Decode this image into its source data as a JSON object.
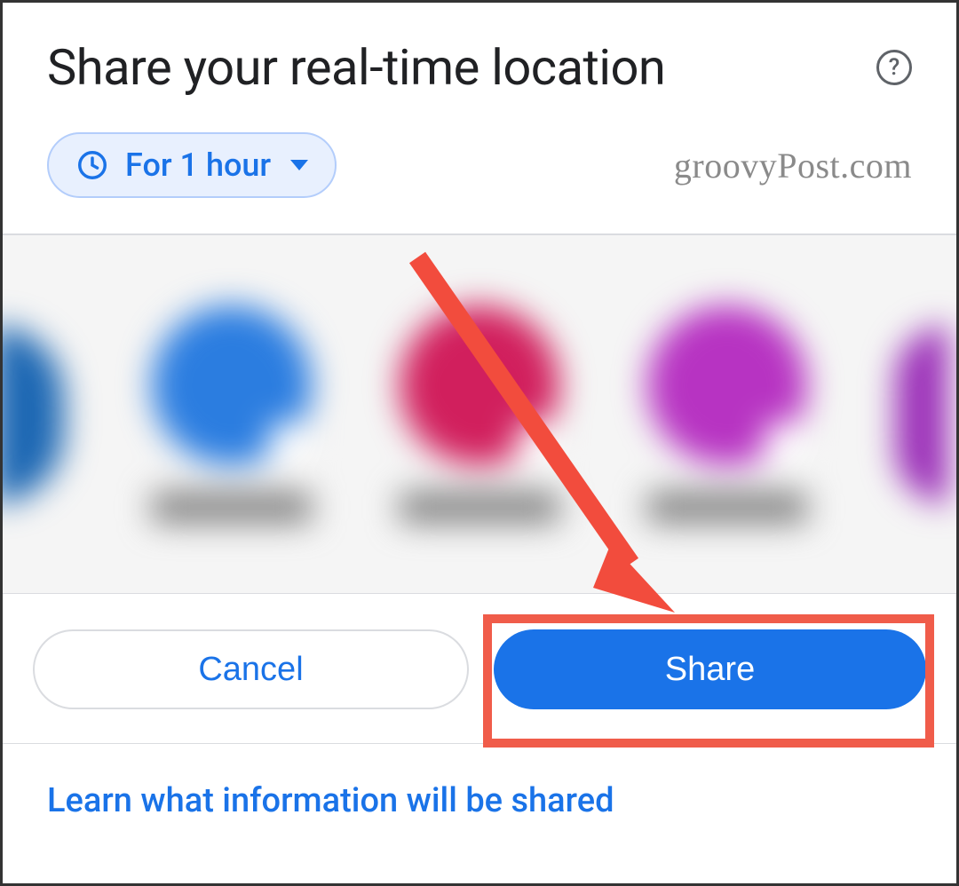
{
  "header": {
    "title": "Share your real-time location"
  },
  "duration": {
    "label": "For 1 hour"
  },
  "watermark": "groovyPost.com",
  "contacts": {
    "colors": [
      "#1c67b3",
      "#2b7de0",
      "#d11f5d",
      "#b733c2",
      "#9b2fb8"
    ]
  },
  "buttons": {
    "cancel": "Cancel",
    "share": "Share"
  },
  "link": {
    "learn": "Learn what information will be shared"
  }
}
